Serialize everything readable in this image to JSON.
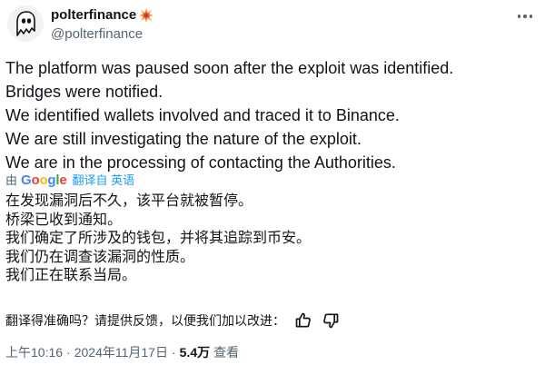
{
  "user": {
    "name": "polterfinance",
    "handle": "@polterfinance"
  },
  "tweet": {
    "lines": [
      "The platform was paused soon after the exploit was identified.",
      "Bridges were notified.",
      "We identified wallets involved and traced it to Binance.",
      "We are still investigating the nature of the exploit.",
      "We are in the processing of contacting the Authorities."
    ]
  },
  "translation": {
    "by_label": "由",
    "provider": "Google",
    "link_label": "翻译自 英语",
    "lines": [
      "在发现漏洞后不久，该平台就被暂停。",
      "桥梁已收到通知。",
      "我们确定了所涉及的钱包，并将其追踪到币安。",
      "我们仍在调查该漏洞的性质。",
      "我们正在联系当局。"
    ],
    "feedback_prompt": "翻译得准确吗？请提供反馈，以便我们加以改进："
  },
  "meta": {
    "time": "上午10:16",
    "date": "2024年11月17日",
    "separator": "·",
    "views_count": "5.4万",
    "views_label": "查看"
  },
  "colors": {
    "text": "#0f1419",
    "secondary": "#536471",
    "link": "#1d9bf0",
    "google_blue": "#4285F4",
    "google_red": "#EA4335",
    "google_yellow": "#FBBC05",
    "google_green": "#34A853"
  },
  "icons": {
    "avatar": "ghost-icon",
    "name_badge": "explosion-icon",
    "more": "more-dots-icon",
    "good": "thumbs-up-icon",
    "bad": "thumbs-down-icon"
  }
}
